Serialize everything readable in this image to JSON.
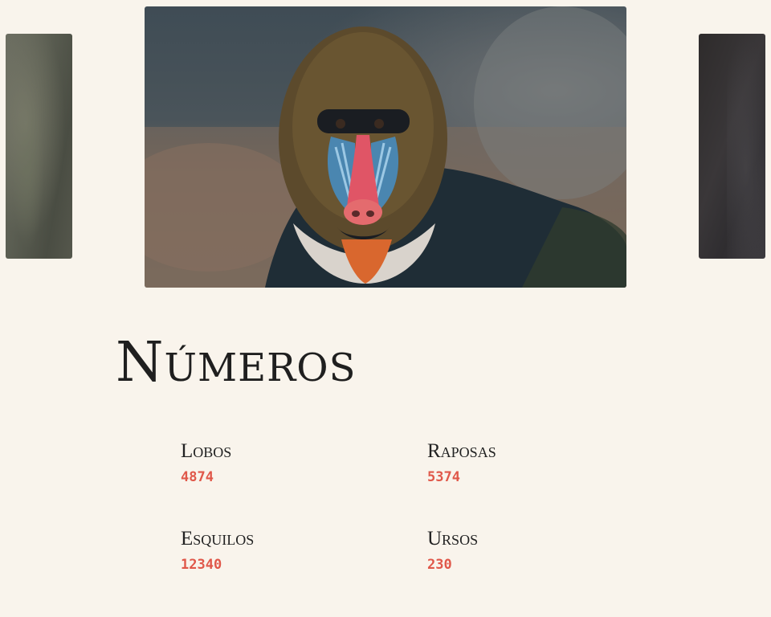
{
  "carousel": {
    "slides": [
      {
        "id": "left",
        "subject": "blurred-green-photo"
      },
      {
        "id": "center",
        "subject": "mandrill-photo"
      },
      {
        "id": "right",
        "subject": "blurred-dark-photo"
      }
    ]
  },
  "numbers": {
    "title": "Números",
    "stats": [
      {
        "label": "Lobos",
        "value": "4874"
      },
      {
        "label": "Raposas",
        "value": "5374"
      },
      {
        "label": "Esquilos",
        "value": "12340"
      },
      {
        "label": "Ursos",
        "value": "230"
      }
    ]
  },
  "colors": {
    "background": "#f9f4ec",
    "accent": "#e0584a",
    "text": "#222222"
  }
}
